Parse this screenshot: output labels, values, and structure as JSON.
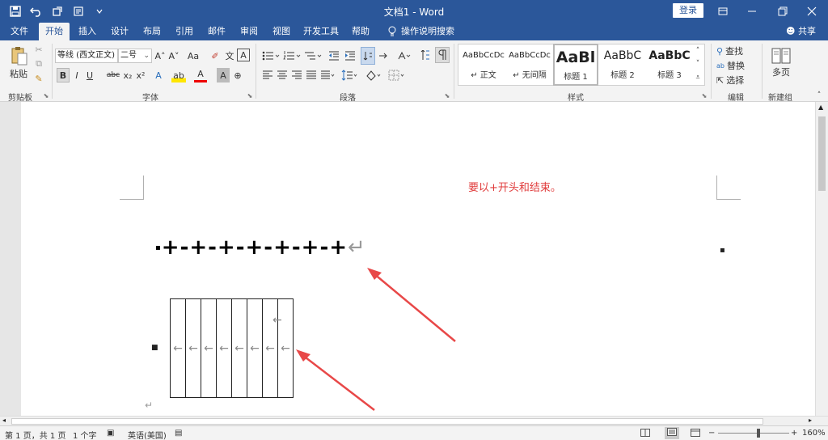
{
  "titlebar": {
    "title": "文档1 - Word",
    "login": "登录",
    "qat_icons": [
      "save-icon",
      "undo-icon",
      "redo-icon",
      "touch-mode-icon",
      "customize-qat-icon"
    ],
    "window_controls": [
      "ribbon-display-icon",
      "minimize-icon",
      "restore-icon",
      "close-icon"
    ]
  },
  "tabs": [
    "文件",
    "开始",
    "插入",
    "设计",
    "布局",
    "引用",
    "邮件",
    "审阅",
    "视图",
    "开发工具",
    "帮助"
  ],
  "active_tab": "开始",
  "tell_me": "操作说明搜索",
  "share": "共享",
  "ribbon": {
    "clipboard": {
      "paste": "粘贴",
      "label": "剪贴板"
    },
    "font": {
      "font_name": "等线 (西文正文)",
      "font_size": "二号",
      "grow": "A˄",
      "shrink": "A˅",
      "case": "Aa",
      "clear_format": "✐",
      "phonetic": "文",
      "border_char": "A",
      "bold": "B",
      "italic": "I",
      "underline": "U",
      "strike": "abc",
      "subscript": "x₂",
      "superscript": "x²",
      "text_effect": "A",
      "highlight": "ab",
      "font_color": "A",
      "shading": "A",
      "enclose": "⊕",
      "label": "字体"
    },
    "paragraph": {
      "label": "段落"
    },
    "styles": {
      "items": [
        {
          "sample": "AaBbCcDc",
          "name": "↵ 正文"
        },
        {
          "sample": "AaBbCcDc",
          "name": "↵ 无间隔"
        },
        {
          "sample": "AaBl",
          "name": "标题 1"
        },
        {
          "sample": "AaBbC",
          "name": "标题 2"
        },
        {
          "sample": "AaBbC",
          "name": "标题 3"
        }
      ],
      "label": "样式"
    },
    "editing": {
      "find": "查找",
      "replace": "替换",
      "select": "选择",
      "label": "编辑"
    },
    "newgroup": {
      "multipage": "多页",
      "label": "新建组"
    }
  },
  "document": {
    "annotation": "要以+开头和结束。",
    "formula_text": "+-+-+-+-+-+-+",
    "pilcrow": "↵",
    "table_cells": 8,
    "table_cell_mark": "←"
  },
  "status": {
    "page": "第 1 页，共 1 页",
    "words": "1 个字",
    "language": "英语(美国)",
    "zoom": "160%"
  },
  "colors": {
    "brand": "#2b579a",
    "annotation": "#e03b3b",
    "arrow": "#e84848"
  }
}
